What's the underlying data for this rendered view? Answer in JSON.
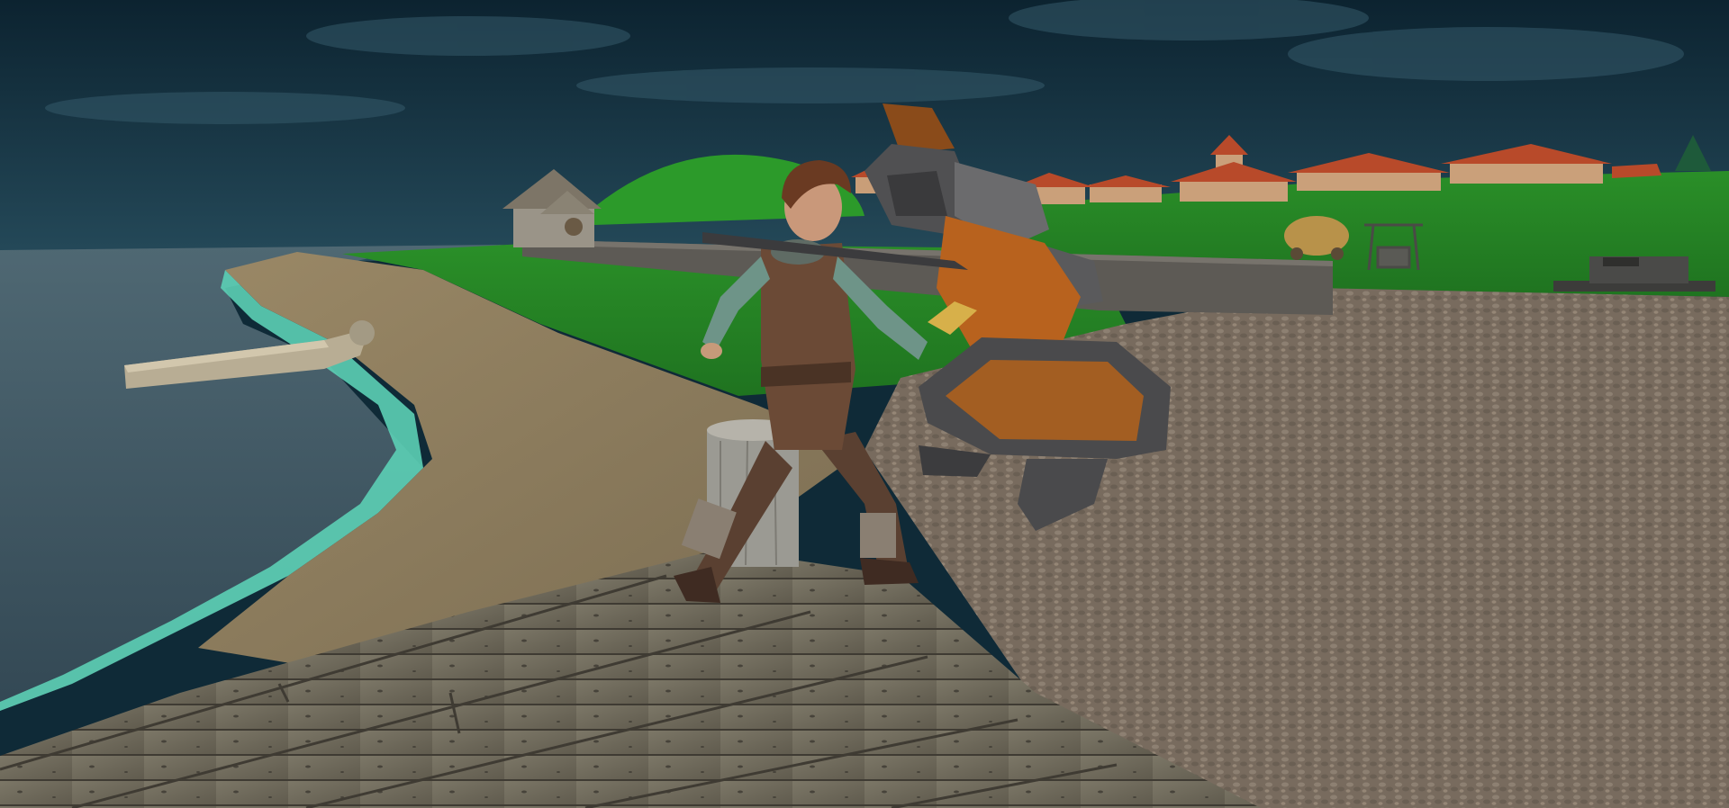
{
  "scene": {
    "description_colors": {
      "sky_top": "#0d2634",
      "sky_bottom": "#1f4252",
      "sea": "#3f5a68",
      "foam": "#5fd1b8",
      "sand": "#8a7a5c",
      "grass": "#2f8f2c",
      "cobble": "#7b6f62",
      "planks": "#6f6a5b",
      "roof": "#b34a2b"
    },
    "characters": [
      {
        "name": "hero",
        "icon": "hero-character"
      },
      {
        "name": "knight",
        "icon": "armored-knight-character"
      }
    ],
    "props": [
      "boat",
      "stump",
      "stone-wall",
      "cottage",
      "village",
      "hay-cart",
      "well",
      "anvil-bench"
    ]
  }
}
